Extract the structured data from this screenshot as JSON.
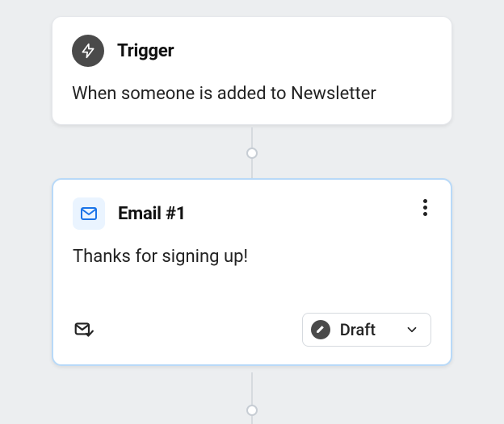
{
  "trigger": {
    "title": "Trigger",
    "description": "When someone is added to Newsletter"
  },
  "email": {
    "title": "Email #1",
    "subject": "Thanks for signing up!",
    "status": "Draft"
  },
  "icons": {
    "trigger": "lightning-icon",
    "email": "envelope-icon",
    "emailCheck": "envelope-check-icon",
    "pencil": "pencil-icon",
    "chevron": "chevron-down-icon",
    "kebab": "more-vertical-icon"
  }
}
